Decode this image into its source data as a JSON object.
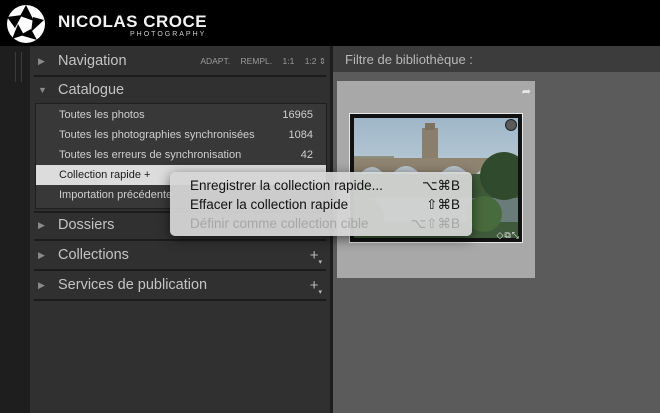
{
  "brand": {
    "name": "NICOLAS CROCE",
    "sub": "PHOTOGRAPHY",
    "icon": "aperture-logo-icon"
  },
  "left_panel": {
    "navigation": {
      "title": "Navigation",
      "options": [
        "ADAPT.",
        "REMPL.",
        "1:1",
        "1:2 ⇕"
      ]
    },
    "catalogue": {
      "title": "Catalogue",
      "items": [
        {
          "label": "Toutes les photos",
          "count": "16965"
        },
        {
          "label": "Toutes les photographies synchronisées",
          "count": "1084"
        },
        {
          "label": "Toutes les erreurs de synchronisation",
          "count": "42"
        },
        {
          "label": "Collection rapide +",
          "count": ""
        },
        {
          "label": "Importation précédente",
          "count": ""
        }
      ]
    },
    "dossiers": {
      "title": "Dossiers"
    },
    "collections": {
      "title": "Collections",
      "action": "+"
    },
    "services": {
      "title": "Services de publication",
      "action": "+"
    }
  },
  "main": {
    "filter_label": "Filtre de bibliothèque :",
    "thumbnail": {
      "badge_icon": "flag-icon",
      "overlay_icons": "◇⧉⤡"
    }
  },
  "context_menu": {
    "items": [
      {
        "label": "Enregistrer la collection rapide...",
        "shortcut": "⌥⌘B",
        "enabled": true
      },
      {
        "label": "Effacer la collection rapide",
        "shortcut": "⇧⌘B",
        "enabled": true
      },
      {
        "label": "Définir comme collection cible",
        "shortcut": "⌥⇧⌘B",
        "enabled": false
      }
    ]
  }
}
